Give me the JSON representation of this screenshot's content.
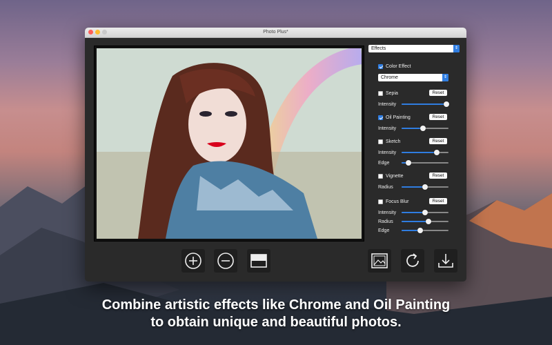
{
  "window": {
    "title": "Photo Plus*"
  },
  "effects_select": {
    "value": "Effects"
  },
  "color_effect": {
    "label": "Color Effect",
    "checked": true,
    "preset": "Chrome"
  },
  "sepia": {
    "label": "Sepia",
    "checked": false,
    "reset": "Reset",
    "sliders": [
      {
        "label": "Intensity",
        "value": 0.95
      }
    ]
  },
  "oil_painting": {
    "label": "Oil Painting",
    "checked": true,
    "reset": "Reset",
    "sliders": [
      {
        "label": "Intensity",
        "value": 0.45
      }
    ]
  },
  "sketch": {
    "label": "Sketch",
    "checked": false,
    "reset": "Reset",
    "sliders": [
      {
        "label": "Intensity",
        "value": 0.75
      },
      {
        "label": "Edge",
        "value": 0.15
      }
    ]
  },
  "vignette": {
    "label": "Vignette",
    "checked": false,
    "reset": "Reset",
    "sliders": [
      {
        "label": "Radius",
        "value": 0.5
      }
    ]
  },
  "focus_blur": {
    "label": "Focus Blur",
    "checked": false,
    "reset": "Reset",
    "sliders": [
      {
        "label": "Intensity",
        "value": 0.5
      },
      {
        "label": "Radius",
        "value": 0.58
      },
      {
        "label": "Edge",
        "value": 0.4
      }
    ]
  },
  "toolbar": {
    "zoom_in_icon": "circle-plus-icon",
    "zoom_out_icon": "circle-minus-icon",
    "compare_icon": "split-view-icon",
    "open_icon": "image-icon",
    "rotate_icon": "rotate-icon",
    "save_icon": "download-icon"
  },
  "caption": {
    "line1": "Combine artistic effects like Chrome and Oil Painting",
    "line2": "to obtain unique and beautiful photos."
  },
  "colors": {
    "accent": "#2f7de1",
    "window_bg": "#2a2a2a"
  }
}
